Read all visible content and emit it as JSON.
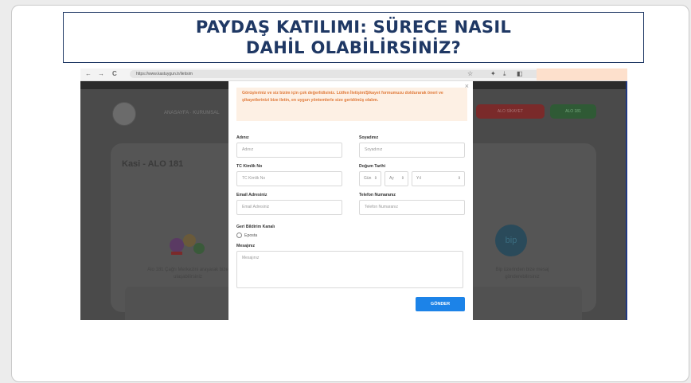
{
  "slide": {
    "title": "PAYDAŞ KATILIMI: SÜRECE NASIL DAHİL OLABİLİRSİNİZ?"
  },
  "browser": {
    "nav_back": "←",
    "nav_forward": "→",
    "nav_reload": "C",
    "url": "https://www.kastuygun.tr/iletisim"
  },
  "background_page": {
    "logo": "",
    "nav_text": "ANASAYFA · KURUMSAL",
    "red_button": "ALO SİKAYET",
    "green_button": "ALO 181",
    "card_title": "Kasi - ALO 181",
    "left_caption": "Alo 181 Çağrı Merkezini arayarak bize ulaşabilirsiniz",
    "right_caption": "Bip üzerinden bize mesaj gönderebilirsiniz",
    "bip_logo": "bip"
  },
  "modal": {
    "close": "×",
    "notice": "Görüşleriniz ve siz bizim için çok değerlidisiniz. Lütfen İletişim/Şikayet formumuzu doldurarak öneri ve şikayetlerinizi bize iletin, en uygun yöntemlerle size geridönüş olalım.",
    "fields": {
      "name_label": "Adınız",
      "name_placeholder": "Adınız",
      "surname_label": "Soyadınız",
      "surname_placeholder": "Soyadınız",
      "tc_label": "TC Kimlik No",
      "tc_placeholder": "TC Kimlik No",
      "birth_label": "Doğum Tarihi",
      "birth_day": "Gün",
      "birth_month": "Ay",
      "birth_year": "Yıl",
      "email_label": "Email Adresiniz",
      "email_placeholder": "Email Adresiniz",
      "phone_label": "Telefon Numaranız",
      "phone_placeholder": "Telefon Numaranız",
      "channel_label": "Geri Bildirim Kanalı",
      "channel_option": "Eposta",
      "message_label": "Mesajınız",
      "message_placeholder": "Mesajınız"
    },
    "submit": "GÖNDER"
  }
}
